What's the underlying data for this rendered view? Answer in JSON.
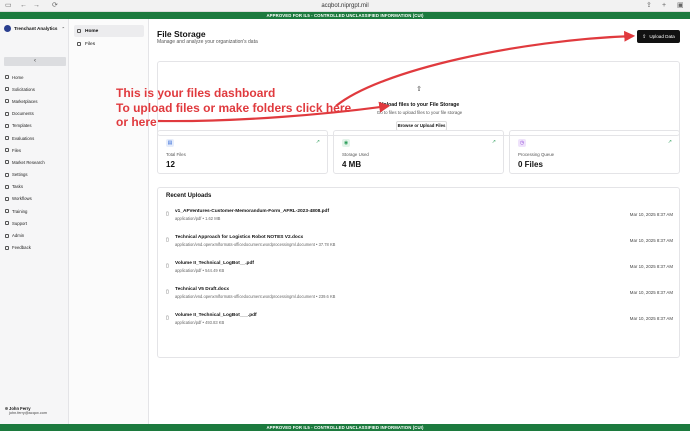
{
  "browser": {
    "url": "acqbot.niprgpt.mil"
  },
  "banner": {
    "top": "APPROVED FOR IL5 - CONTROLLED UNCLASSIFIED INFORMATION (CUI)",
    "bottom": "APPROVED FOR IL5 - CONTROLLED UNCLASSIFIED INFORMATION (CUI)"
  },
  "sidebar": {
    "org_name": "Trenchant Analytics",
    "collapse_icon": "chevron-left-icon",
    "items": [
      {
        "label": "Home"
      },
      {
        "label": "Solicitations"
      },
      {
        "label": "Marketplaces"
      },
      {
        "label": "Documents"
      },
      {
        "label": "Templates"
      },
      {
        "label": "Evaluations"
      },
      {
        "label": "Files"
      },
      {
        "label": "Market Research"
      },
      {
        "label": "Settings"
      },
      {
        "label": "Tasks"
      },
      {
        "label": "Workflows"
      },
      {
        "label": "Training"
      },
      {
        "label": "Support"
      },
      {
        "label": "Admin"
      },
      {
        "label": "Feedback"
      }
    ],
    "user": {
      "name": "John Ferry",
      "email": "john.ferry@acqox.com"
    }
  },
  "files_panel": {
    "items": [
      {
        "label": "Home"
      },
      {
        "label": "Files"
      }
    ]
  },
  "main": {
    "title": "File Storage",
    "subtitle": "Manage and analyze your organization's data",
    "upload_button": "Upload Data",
    "dropzone": {
      "title": "Upload files to your File Storage",
      "subtitle": "Go to files to upload files to your file storage",
      "button": "Browse or Upload Files"
    },
    "stats": [
      {
        "label": "Total Files",
        "value": "12",
        "icon": "file-icon",
        "color": "#3b6fd8"
      },
      {
        "label": "Storage Used",
        "value": "4 MB",
        "icon": "database-icon",
        "color": "#2e9e5b"
      },
      {
        "label": "Processing Queue",
        "value": "0 Files",
        "icon": "clock-icon",
        "color": "#8b3fd6"
      }
    ],
    "recent": {
      "title": "Recent Uploads",
      "rows": [
        {
          "name": "v1_AFVentures-Customer-Memorandum-Form_AFRL-2023-4808.pdf",
          "meta": "application/pdf • 1.62 MB",
          "date": "Mar 10, 2025 8:37 AM"
        },
        {
          "name": "Technical Approach for Logistics Robot NOTES V2.docx",
          "meta": "application/vnd.openxmlformats-officedocument.wordprocessingml.document • 37.78 KB",
          "date": "Mar 10, 2025 8:37 AM"
        },
        {
          "name": "Volume II_Technical_LogBot__.pdf",
          "meta": "application/pdf • 544.49 KB",
          "date": "Mar 10, 2025 8:37 AM"
        },
        {
          "name": "Technical V5 Draft.docx",
          "meta": "application/vnd.openxmlformats-officedocument.wordprocessingml.document • 239.6 KB",
          "date": "Mar 10, 2025 8:37 AM"
        },
        {
          "name": "Volume II_Technical_LogBot___.pdf",
          "meta": "application/pdf • 493.83 KB",
          "date": "Mar 10, 2025 8:37 AM"
        }
      ]
    }
  },
  "annotation": {
    "line1": "This is your files dashboard",
    "line2": "To upload files or make folders click here",
    "line3": "or here",
    "color": "#e03a3e"
  }
}
